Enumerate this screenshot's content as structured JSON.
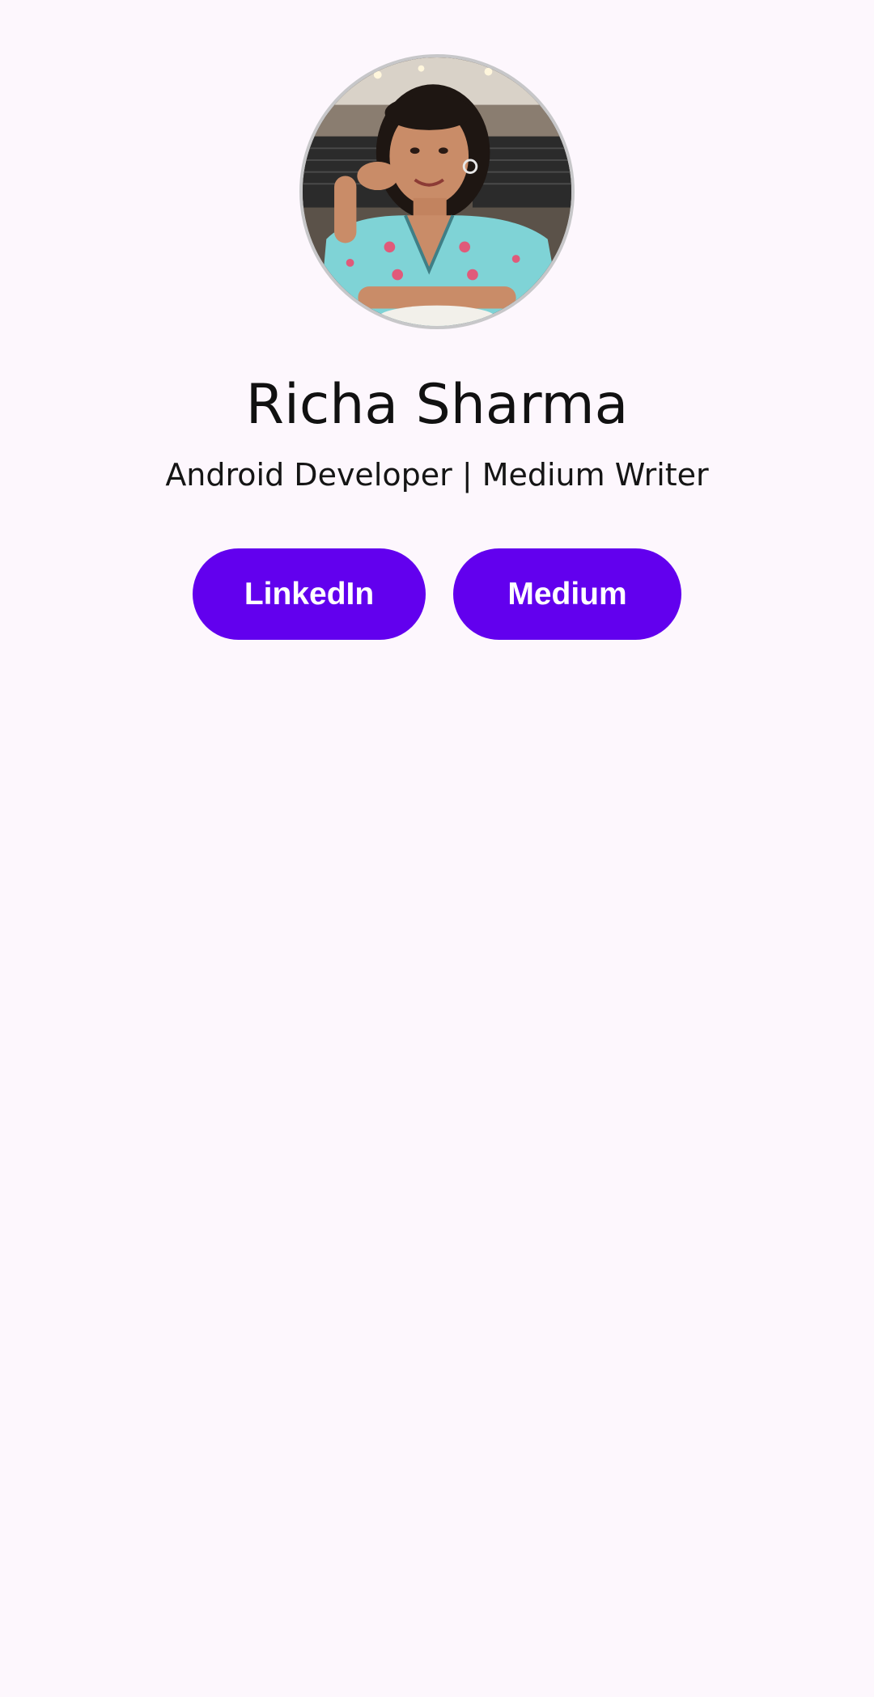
{
  "profile": {
    "name": "Richa Sharma",
    "tagline": "Android Developer | Medium Writer",
    "avatar_icon": "profile-photo"
  },
  "actions": {
    "linkedin_label": "LinkedIn",
    "medium_label": "Medium"
  },
  "colors": {
    "background": "#fdf7fd",
    "button": "#6200ee",
    "button_text": "#ffffff",
    "avatar_border": "#c7c7c9"
  }
}
